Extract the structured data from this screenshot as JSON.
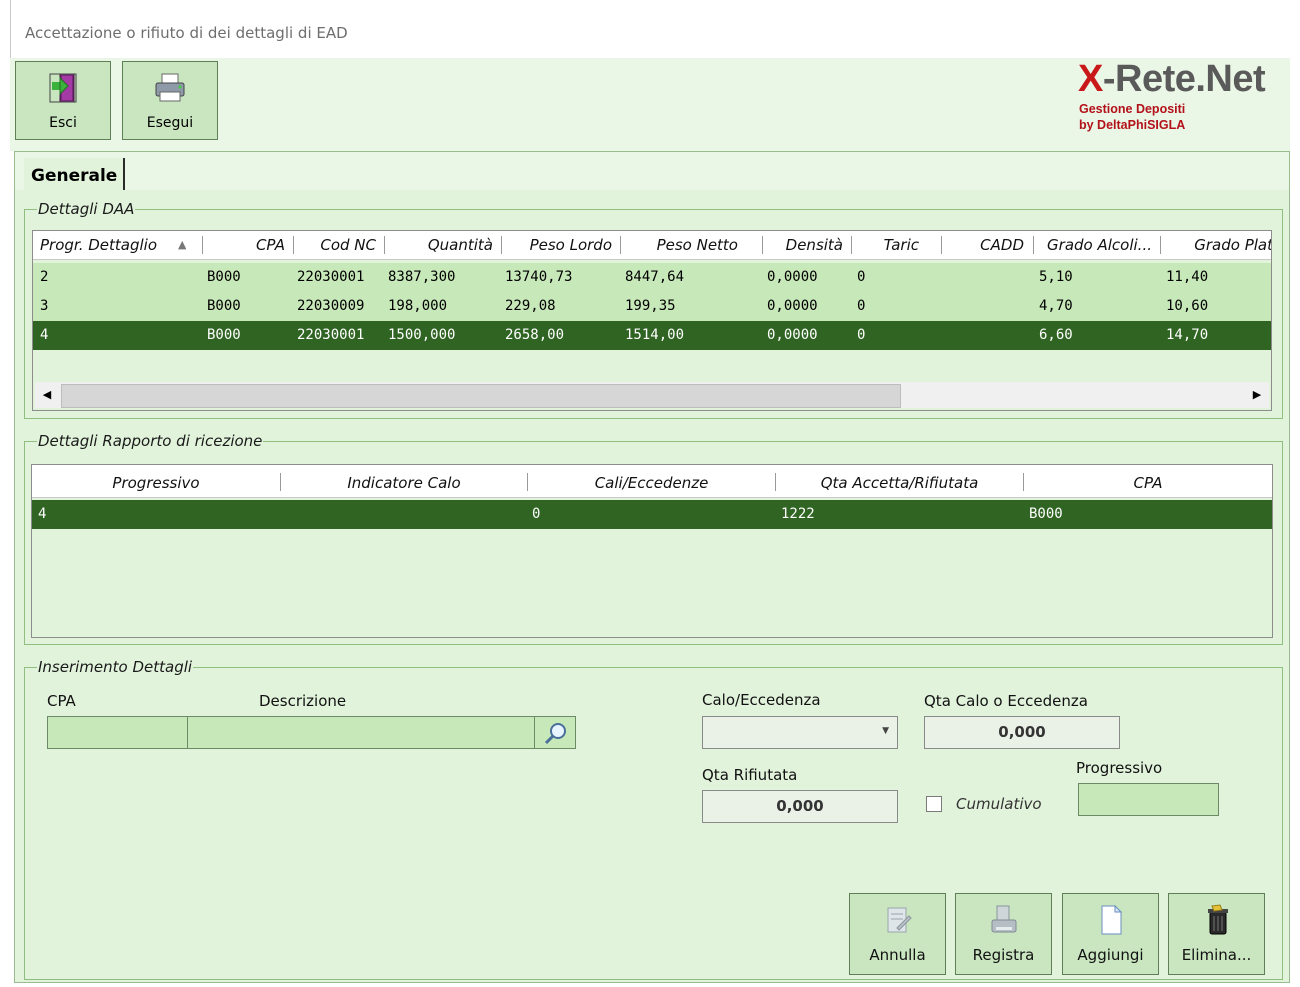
{
  "window": {
    "title": "Accettazione o rifiuto di dei dettagli di EAD"
  },
  "toolbar": {
    "esci_label": "Esci",
    "esegui_label": "Esegui"
  },
  "logo": {
    "brand_x": "X",
    "brand_rest": "-Rete.Net",
    "line1": "Gestione Depositi",
    "line2": "by DeltaPhiSIGLA"
  },
  "tabs": [
    {
      "label": "Generale"
    }
  ],
  "daa": {
    "legend": "Dettagli DAA",
    "columns": [
      "Progr. Dettaglio",
      "CPA",
      "Cod NC",
      "Quantità",
      "Peso Lordo",
      "Peso Netto",
      "Densità",
      "Taric",
      "CADD",
      "Grado Alcoli...",
      "Grado Plat"
    ],
    "rows": [
      [
        "2",
        "B000",
        "22030001",
        "8387,300",
        "13740,73",
        "8447,64",
        "0,0000",
        "0",
        "",
        "5,10",
        "11,40"
      ],
      [
        "3",
        "B000",
        "22030009",
        "198,000",
        "229,08",
        "199,35",
        "0,0000",
        "0",
        "",
        "4,70",
        "10,60"
      ],
      [
        "4",
        "B000",
        "22030001",
        "1500,000",
        "2658,00",
        "1514,00",
        "0,0000",
        "0",
        "",
        "6,60",
        "14,70"
      ]
    ],
    "selected_row": 2
  },
  "rapporto": {
    "legend": "Dettagli Rapporto di ricezione",
    "columns": [
      "Progressivo",
      "Indicatore Calo",
      "Cali/Eccedenze",
      "Qta Accetta/Rifiutata",
      "CPA"
    ],
    "rows": [
      [
        "4",
        "",
        "0",
        "1222",
        "B000"
      ]
    ]
  },
  "inserimento": {
    "legend": "Inserimento Dettagli",
    "cpa_label": "CPA",
    "descrizione_label": "Descrizione",
    "calo_label": "Calo/Eccedenza",
    "qta_calo_label": "Qta Calo o Eccedenza",
    "qta_calo_value": "0,000",
    "qta_rifiutata_label": "Qta Rifiutata",
    "qta_rifiutata_value": "0,000",
    "cumulativo_label": "Cumulativo",
    "progressivo_label": "Progressivo"
  },
  "actions": {
    "annulla": "Annulla",
    "registra": "Registra",
    "aggiungi": "Aggiungi",
    "elimina": "Elimina..."
  }
}
